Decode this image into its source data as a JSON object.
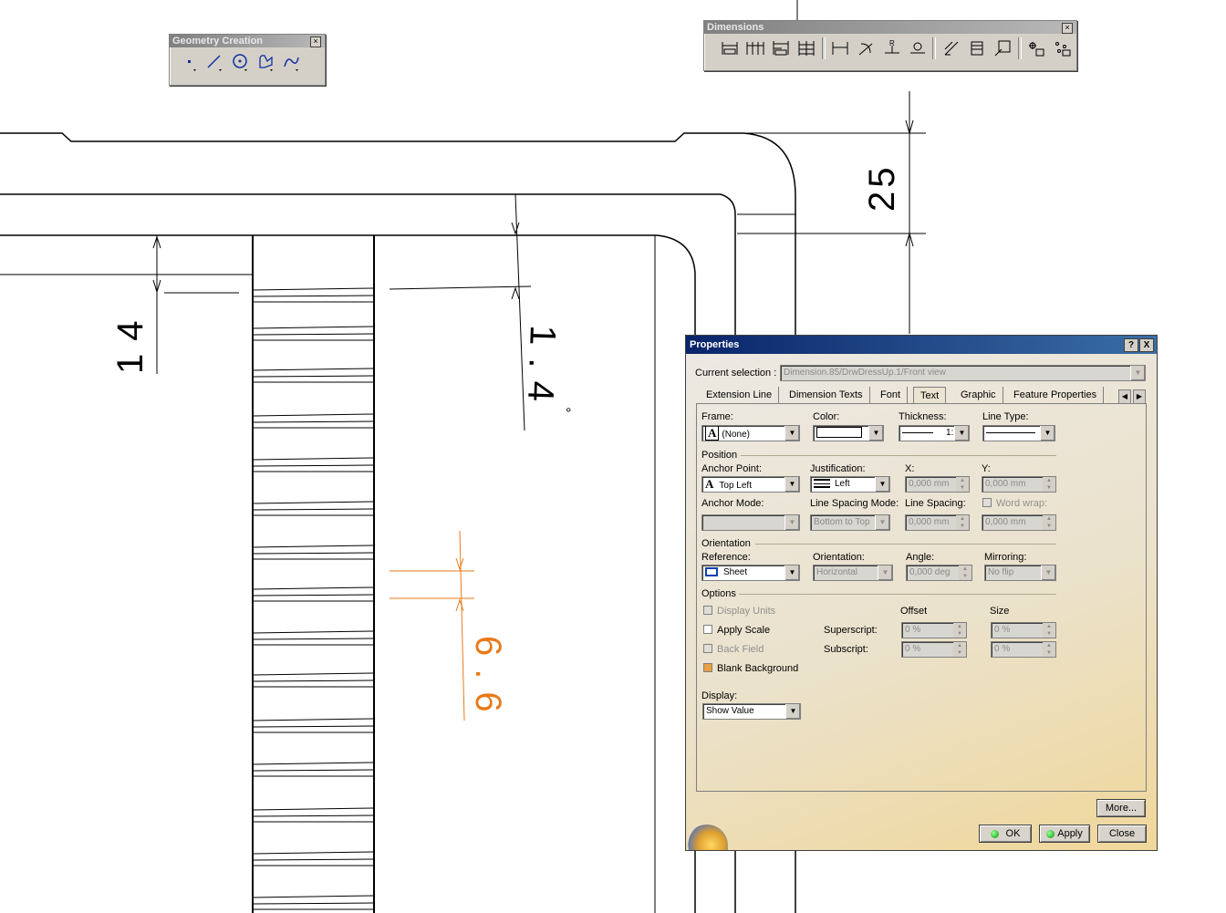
{
  "drawing": {
    "dim_14": "14",
    "dim_25": "25",
    "dim_14deg": "1.4",
    "dim_66": "6.6",
    "dim_color": "#e87a1a"
  },
  "geometry_toolbar": {
    "title": "Geometry Creation",
    "icons": [
      "point-icon",
      "line-icon",
      "circle-icon",
      "profile-icon",
      "spline-icon"
    ]
  },
  "dimensions_toolbar": {
    "title": "Dimensions",
    "icons": [
      "dimensions-icon",
      "chained-dimensions-icon",
      "cumulated-dimensions-icon",
      "stacked-dimensions-icon",
      "length-distance-icon",
      "angle-dimension-icon",
      "radius-dimension-icon",
      "diameter-dimension-icon",
      "chamfer-dimension-icon",
      "thread-dimension-icon",
      "coordinate-dimension-icon",
      "hole-table-icon",
      "point-coordinate-table-icon"
    ]
  },
  "properties": {
    "title": "Properties",
    "help_btn": "?",
    "close_btn": "X",
    "current_selection_label": "Current selection :",
    "current_selection_value": "Dimension.85/DrwDressUp.1/Front view",
    "tabs": [
      "Extension Line",
      "Dimension Texts",
      "Font",
      "Text",
      "Graphic",
      "Feature Properties"
    ],
    "active_tab": "Text",
    "frame_label": "Frame:",
    "frame_value": "(None)",
    "color_label": "Color:",
    "thickness_label": "Thickness:",
    "thickness_value": "1:",
    "linetype_label": "Line Type:",
    "position_label": "Position",
    "anchor_point_label": "Anchor Point:",
    "anchor_point_value": "Top Left",
    "justification_label": "Justification:",
    "justification_value": "Left",
    "x_label": "X:",
    "x_value": "0,000 mm",
    "y_label": "Y:",
    "y_value": "0,000 mm",
    "anchor_mode_label": "Anchor Mode:",
    "line_spacing_mode_label": "Line Spacing Mode:",
    "line_spacing_mode_value": "Bottom to Top",
    "line_spacing_label": "Line Spacing:",
    "line_spacing_value": "0,000 mm",
    "word_wrap_label": "Word wrap:",
    "word_wrap_value": "0,000 mm",
    "orientation_group_label": "Orientation",
    "reference_label": "Reference:",
    "reference_value": "Sheet",
    "orientation_label": "Orientation:",
    "orientation_value": "Horizontal",
    "angle_label": "Angle:",
    "angle_value": "0,000 deg",
    "mirroring_label": "Mirroring:",
    "mirroring_value": "No flip",
    "options_label": "Options",
    "display_units_label": "Display Units",
    "apply_scale_label": "Apply Scale",
    "back_field_label": "Back Field",
    "blank_background_label": "Blank Background",
    "offset_label": "Offset",
    "size_label": "Size",
    "superscript_label": "Superscript:",
    "subscript_label": "Subscript:",
    "super_offset": "0 %",
    "super_size": "0 %",
    "sub_offset": "0 %",
    "sub_size": "0 %",
    "display_label": "Display:",
    "display_value": "Show Value",
    "more_btn": "More...",
    "ok_btn": "OK",
    "apply_btn": "Apply",
    "close_dialog_btn": "Close"
  }
}
